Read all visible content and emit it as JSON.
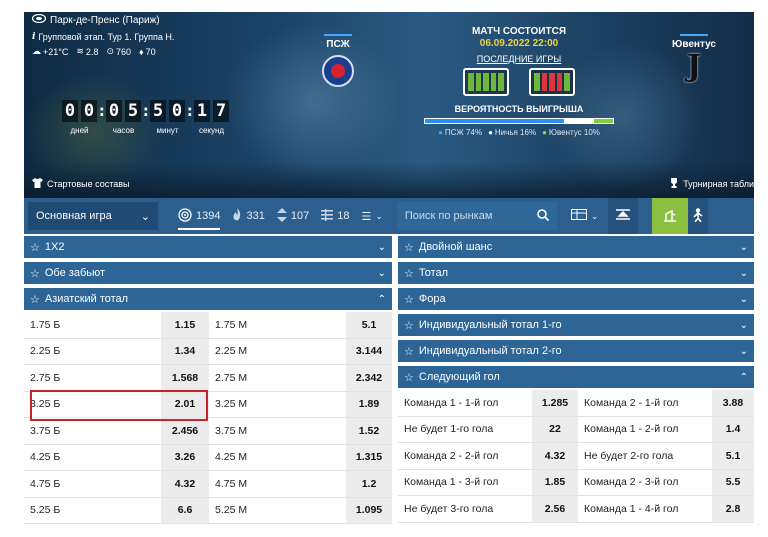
{
  "venue": "Парк-де-Пренс (Париж)",
  "stage": "Групповой этап. Тур 1. Группа H.",
  "weather": {
    "temp": "+21°C",
    "wind": "2.8",
    "pressure": "760",
    "humidity": "70"
  },
  "countdown": {
    "units": [
      {
        "digits": [
          "0",
          "0"
        ],
        "label": "дней"
      },
      {
        "digits": [
          "0",
          "5"
        ],
        "label": "часов"
      },
      {
        "digits": [
          "5",
          "0"
        ],
        "label": "минут"
      },
      {
        "digits": [
          "1",
          "7"
        ],
        "label": "секунд"
      }
    ]
  },
  "home_team": "ПСЖ",
  "away_team": "Ювентус",
  "match": {
    "title": "МАТЧ СОСТОИТСЯ",
    "date": "06.09.2022 22:00",
    "last_games": "ПОСЛЕДНИЕ ИГРЫ",
    "home_form": [
      "W",
      "W",
      "W",
      "W",
      "W"
    ],
    "away_form": [
      "W",
      "L",
      "L",
      "L",
      "W"
    ],
    "probability_title": "ВЕРОЯТНОСТЬ ВЫИГРЫША",
    "probability": {
      "home": 74,
      "draw": 16,
      "away": 10
    },
    "legend": {
      "home": "ПСЖ 74%",
      "draw": "Ничья 16%",
      "away": "Ювентус 10%"
    }
  },
  "lineups_label": "Стартовые составы",
  "standings_label": "Турнирная табли",
  "nav": {
    "select": "Основная игра",
    "all_count": "1394",
    "live_count": "331",
    "movers_count": "107",
    "stats_count": "18",
    "search_placeholder": "Поиск по рынкам"
  },
  "colors": {
    "header": "#2c6596",
    "nav": "#2c5f8d",
    "accent_green": "#8cbf3f",
    "highlight": "#c8232c",
    "date": "#f2d33b"
  },
  "left_markets": [
    {
      "title": "1Х2",
      "expanded": false
    },
    {
      "title": "Обе забьют",
      "expanded": false
    },
    {
      "title": "Азиатский тотал",
      "expanded": true
    }
  ],
  "asian_total": [
    {
      "over": "1.75 Б",
      "over_odd": "1.15",
      "under": "1.75 М",
      "under_odd": "5.1"
    },
    {
      "over": "2.25 Б",
      "over_odd": "1.34",
      "under": "2.25 М",
      "under_odd": "3.144"
    },
    {
      "over": "2.75 Б",
      "over_odd": "1.568",
      "under": "2.75 М",
      "under_odd": "2.342"
    },
    {
      "over": "3.25 Б",
      "over_odd": "2.01",
      "under": "3.25 М",
      "under_odd": "1.89"
    },
    {
      "over": "3.75 Б",
      "over_odd": "2.456",
      "under": "3.75 М",
      "under_odd": "1.52"
    },
    {
      "over": "4.25 Б",
      "over_odd": "3.26",
      "under": "4.25 М",
      "under_odd": "1.315"
    },
    {
      "over": "4.75 Б",
      "over_odd": "4.32",
      "under": "4.75 М",
      "under_odd": "1.2"
    },
    {
      "over": "5.25 Б",
      "over_odd": "6.6",
      "under": "5.25 М",
      "under_odd": "1.095"
    }
  ],
  "right_markets": [
    {
      "title": "Двойной шанс",
      "expanded": false
    },
    {
      "title": "Тотал",
      "expanded": false
    },
    {
      "title": "Фора",
      "expanded": false
    },
    {
      "title": "Индивидуальный тотал 1-го",
      "expanded": false
    },
    {
      "title": "Индивидуальный тотал 2-го",
      "expanded": false
    },
    {
      "title": "Следующий гол",
      "expanded": true
    }
  ],
  "next_goal": [
    {
      "a": "Команда 1 - 1-й гол",
      "a_odd": "1.285",
      "b": "Команда 2 - 1-й гол",
      "b_odd": "3.88"
    },
    {
      "a": "Не будет 1-го гола",
      "a_odd": "22",
      "b": "Команда 1 - 2-й гол",
      "b_odd": "1.4"
    },
    {
      "a": "Команда 2 - 2-й гол",
      "a_odd": "4.32",
      "b": "Не будет 2-го гола",
      "b_odd": "5.1"
    },
    {
      "a": "Команда 1 - 3-й гол",
      "a_odd": "1.85",
      "b": "Команда 2 - 3-й гол",
      "b_odd": "5.5"
    },
    {
      "a": "Не будет 3-го гола",
      "a_odd": "2.56",
      "b": "Команда 1 - 4-й гол",
      "b_odd": "2.8"
    }
  ]
}
